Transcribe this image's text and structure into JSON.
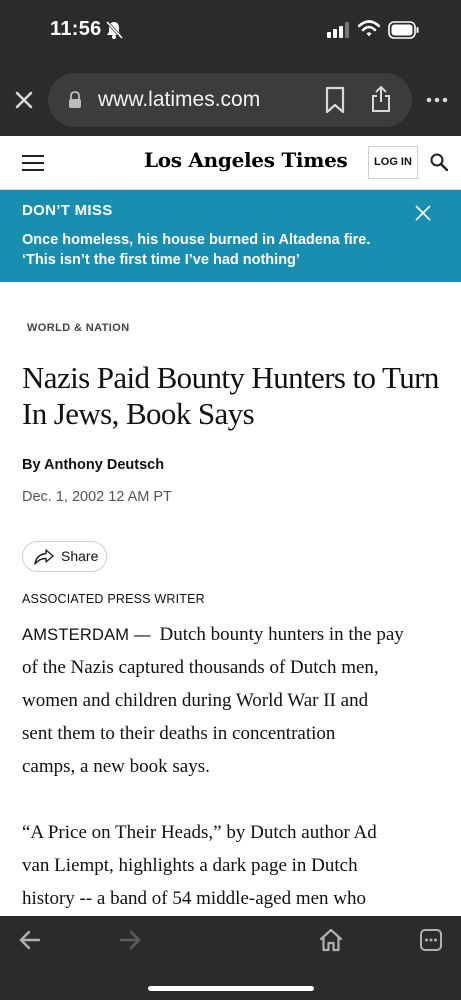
{
  "status": {
    "time": "11:56"
  },
  "browser": {
    "url": "www.latimes.com"
  },
  "site": {
    "logo": "Los Angeles Times",
    "login_label": "LOG IN"
  },
  "banner": {
    "kicker": "DON’T MISS",
    "line1": "Once homeless, his house burned in Altadena fire.",
    "line2": "‘This isn’t the first time I’ve had nothing’"
  },
  "article": {
    "section": "WORLD & NATION",
    "headline_line1": "Nazis Paid Bounty Hunters to Turn",
    "headline_line2": "In Jews, Book Says",
    "byline": "By Anthony Deutsch",
    "date": "Dec. 1, 2002 12 AM PT",
    "share_label": "Share",
    "wire_label": "ASSOCIATED PRESS WRITER",
    "dateline": "AMSTERDAM —",
    "p1_line1": "Dutch bounty hunters in the pay",
    "p1_line2": "of the Nazis captured thousands of Dutch men,",
    "p1_line3": "women and children during World War II and",
    "p1_line4": "sent them to their deaths in concentration",
    "p1_line5": "camps, a new book says.",
    "p2_line1": "“A Price on Their Heads,” by Dutch author Ad",
    "p2_line2": "van Liempt, highlights a dark page in Dutch",
    "p2_line3": "history -- a band of 54 middle-aged men who"
  },
  "colors": {
    "banner": "#1a8eb0",
    "chrome": "#2b2b2d"
  }
}
